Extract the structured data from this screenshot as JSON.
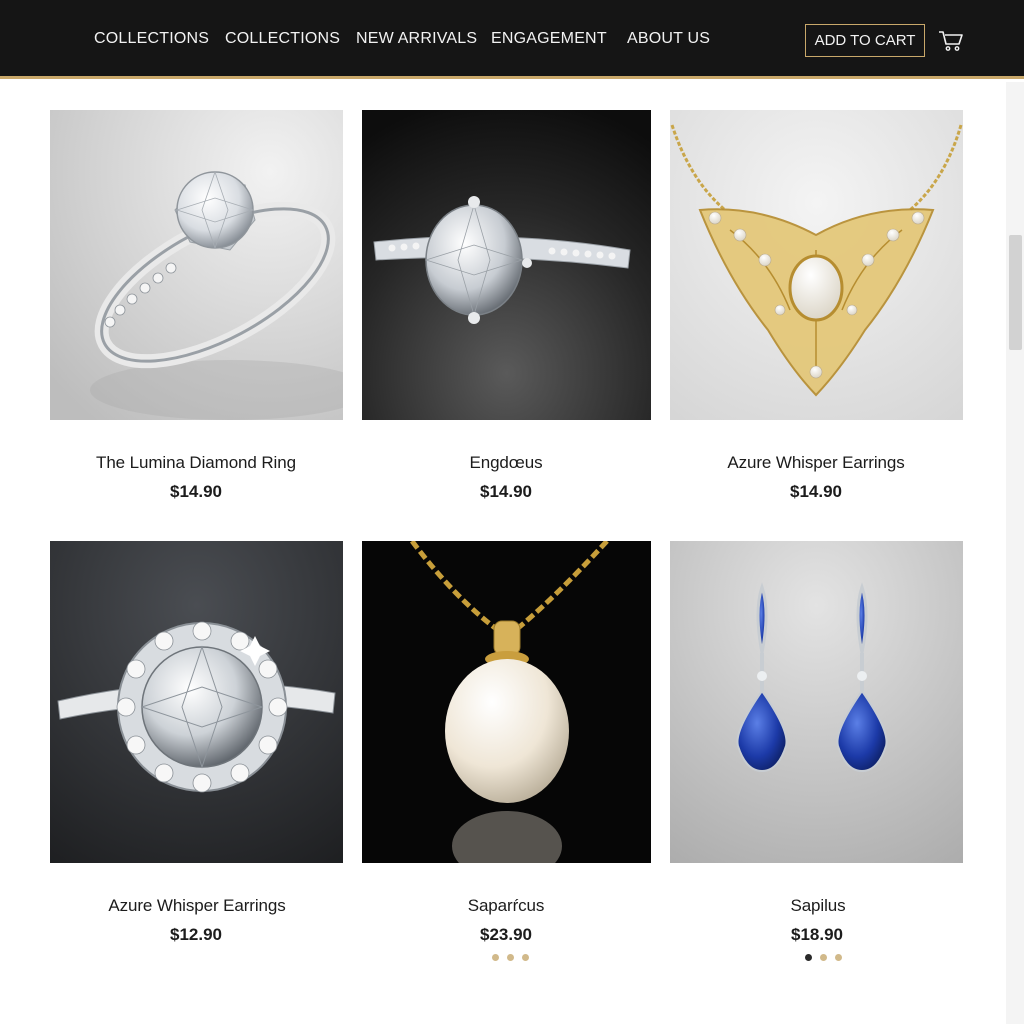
{
  "header": {
    "nav": [
      "COLLECTIONS",
      "COLLECTIONS",
      "NEW ARRIVALS",
      "ENGAGEMENT",
      "ABOUT US"
    ],
    "add_to_cart": "ADD TO CART",
    "cart_icon": "shopping-cart-icon",
    "accent_color": "#c9a86a",
    "bar_color": "#151515"
  },
  "products": [
    {
      "name": "The Lumina Diamond Ring",
      "price": "$14.90",
      "image": "diamond-solitaire-ring"
    },
    {
      "name": "Engdœus",
      "price": "$14.90",
      "image": "diamond-ring-dark"
    },
    {
      "name": "Azure Whisper Earrings",
      "price": "$14.90",
      "image": "gold-pearl-necklace"
    },
    {
      "name": "Azure Whisper Earrings",
      "price": "$12.90",
      "image": "halo-diamond-ring"
    },
    {
      "name": "Saparŕcus",
      "price": "$23.90",
      "image": "pearl-pendant"
    },
    {
      "name": "Sapilus",
      "price": "$18.90",
      "image": "sapphire-drop-earrings"
    }
  ],
  "carousel_dots": {
    "pearl_pendant": {
      "count": 3,
      "active_index": null
    },
    "sapphire_earrings": {
      "count": 3,
      "active_index": 0
    }
  }
}
